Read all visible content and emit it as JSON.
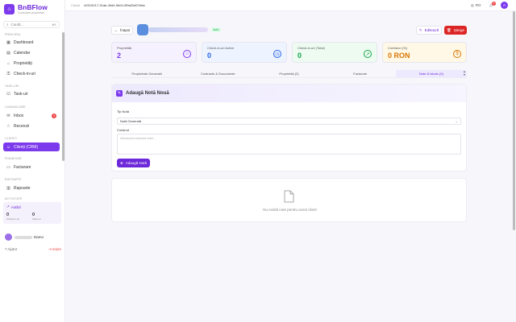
{
  "brand": {
    "name": "BnBFlow",
    "tagline": "Conectare proprietari",
    "logo_icon": "house-icon"
  },
  "sidebar": {
    "search_placeholder": "Caută...",
    "search_shortcut": "⌘K",
    "sections": {
      "general": "Principal",
      "tasks": "Task-uri",
      "communication": "Comunicare",
      "clients": "Clienți",
      "finance": "Financiar",
      "reports": "Rapoarte",
      "activity": "Activitate"
    },
    "items": {
      "dashboard": "Dashboard",
      "calendar": "Calendar",
      "properties": "Proprietăți",
      "checkins": "Check-in-uri",
      "tasks": "Task-uri",
      "inbox": "Inbox",
      "inbox_badge": "3",
      "reviews": "Recenzii",
      "clients": "Clienți (CRM)",
      "invoicing": "Facturare",
      "reports": "Rapoarte"
    },
    "activity": {
      "title": "Astăzi",
      "checkins_value": "0",
      "checkins_label": "Check-in-uri",
      "tasks_value": "0",
      "tasks_label": "Task-uri"
    },
    "user_name": "Damo",
    "help_label": "Ajutor",
    "logout_label": "Ieșire"
  },
  "topbar": {
    "crumb_label": "Clienți",
    "client_id": "#2219217-31ab-40d4-9b04-0f9a20d07b6a",
    "lang": "RO",
    "notif_count": "8",
    "avatar_letter": "A"
  },
  "header": {
    "back_label": "Înapoi",
    "status": "Activ",
    "edit_label": "Editează",
    "delete_label": "Șterge"
  },
  "stats": [
    {
      "label": "Proprietăți",
      "value": "2",
      "color": "#7c3aed",
      "bg": "#f5f1fe"
    },
    {
      "label": "Check-in-uri Active",
      "value": "0",
      "color": "#2563eb",
      "bg": "#eef4ff"
    },
    {
      "label": "Check-in-uri (Total)",
      "value": "0",
      "color": "#16a34a",
      "bg": "#edfbf1"
    },
    {
      "label": "Comision (%)",
      "value": "0 RON",
      "color": "#d97706",
      "bg": "#fff8e6"
    }
  ],
  "tabs": [
    "Proprietate Generală",
    "Contracte & Documente",
    "Proprietăți (2)",
    "Facturare",
    "Note & Istoric (0)"
  ],
  "note_form": {
    "title": "Adaugă Notă Nouă",
    "type_label": "Tip Notă",
    "type_value": "Notă Generală",
    "content_label": "Conținut",
    "content_placeholder": "Introduceți conținutul notei...",
    "submit_label": "Adaugă Notă"
  },
  "empty_state": {
    "text": "Nu există note pentru acest client"
  }
}
